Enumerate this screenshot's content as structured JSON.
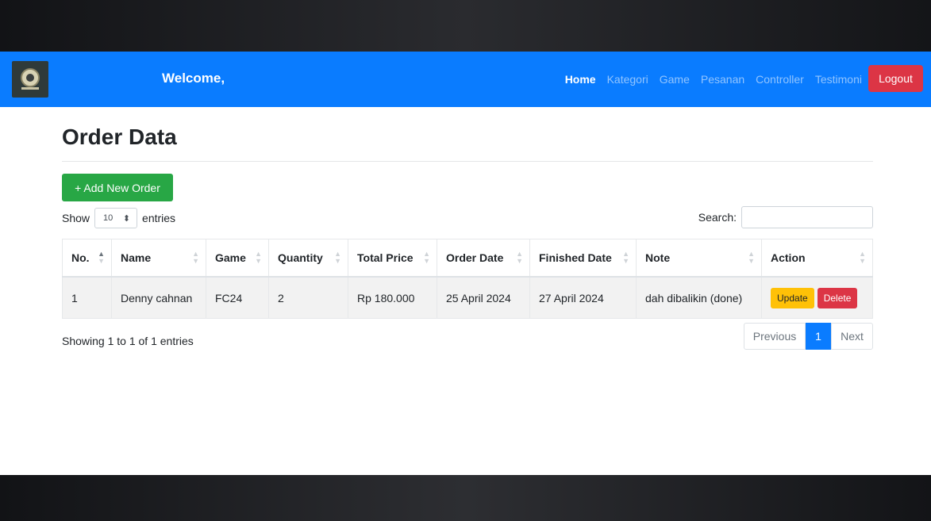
{
  "navbar": {
    "welcome": "Welcome,",
    "links": [
      "Home",
      "Kategori",
      "Game",
      "Pesanan",
      "Controller",
      "Testimoni"
    ],
    "active_link": "Home",
    "logout_label": "Logout",
    "logo_icon": "game-controller-logo-icon"
  },
  "page": {
    "title": "Order Data",
    "add_button": "+ Add New Order"
  },
  "table_controls": {
    "show_label": "Show",
    "entries_value": "10",
    "entries_label": "entries",
    "search_label": "Search:",
    "search_value": ""
  },
  "table": {
    "columns": [
      "No.",
      "Name",
      "Game",
      "Quantity",
      "Total Price",
      "Order Date",
      "Finished Date",
      "Note",
      "Action"
    ],
    "sorted_column": "No.",
    "rows": [
      {
        "no": "1",
        "name": "Denny cahnan",
        "game": "FC24",
        "quantity": "2",
        "total_price": "Rp 180.000",
        "order_date": "25 April 2024",
        "finished_date": "27 April 2024",
        "note": "dah dibalikin (done)",
        "update_label": "Update",
        "delete_label": "Delete"
      }
    ]
  },
  "footer": {
    "info": "Showing 1 to 1 of 1 entries",
    "previous": "Previous",
    "page": "1",
    "next": "Next"
  },
  "colors": {
    "navbar": "#0a7cff",
    "logout": "#dc3545",
    "add_button": "#28a745",
    "update": "#ffc107",
    "delete": "#dc3545"
  }
}
